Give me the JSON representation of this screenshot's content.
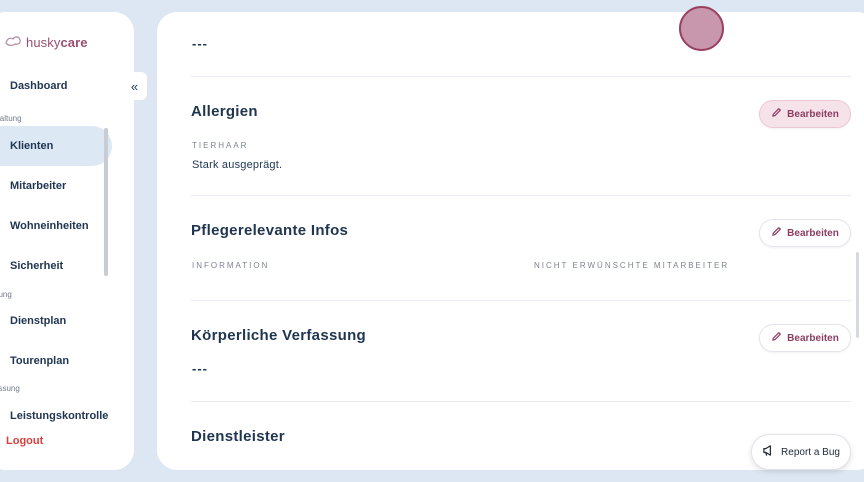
{
  "app": {
    "logo_primary": "husky",
    "logo_accent": "care"
  },
  "sidebar": {
    "items": [
      {
        "label": "Dashboard"
      },
      {
        "label": "Klienten"
      },
      {
        "label": "Mitarbeiter"
      },
      {
        "label": "Wohneinheiten"
      },
      {
        "label": "Sicherheit"
      },
      {
        "label": "Dienstplan"
      },
      {
        "label": "Tourenplan"
      },
      {
        "label": "Leistungskontrolle"
      }
    ],
    "sections": [
      "waltung",
      "nung",
      "assung"
    ],
    "active_item": "Klienten",
    "logout": "Logout",
    "collapse_icon": "«"
  },
  "main": {
    "top_value": "---",
    "sections": {
      "allergien": {
        "title": "Allergien",
        "field_label": "TIERHAAR",
        "field_value": "Stark ausgeprägt.",
        "edit_label": "Bearbeiten"
      },
      "pflege": {
        "title": "Pflegerelevante Infos",
        "label_information": "INFORMATION",
        "label_unwanted": "NICHT ERWÜNSCHTE MITARBEITER",
        "edit_label": "Bearbeiten"
      },
      "koerper": {
        "title": "Körperliche Verfassung",
        "value": "---",
        "edit_label": "Bearbeiten"
      },
      "dienstleister": {
        "title": "Dienstleister"
      }
    }
  },
  "report_bug": {
    "label": "Report a Bug"
  },
  "colors": {
    "accent": "#8c3e62",
    "logout": "#d9413c",
    "active_bg": "#dde8f5",
    "background": "#dde6f3"
  },
  "icons": {
    "logo": "paw-icon",
    "edit": "pencil-icon",
    "report": "megaphone-icon",
    "collapse": "double-chevron-left-icon"
  }
}
